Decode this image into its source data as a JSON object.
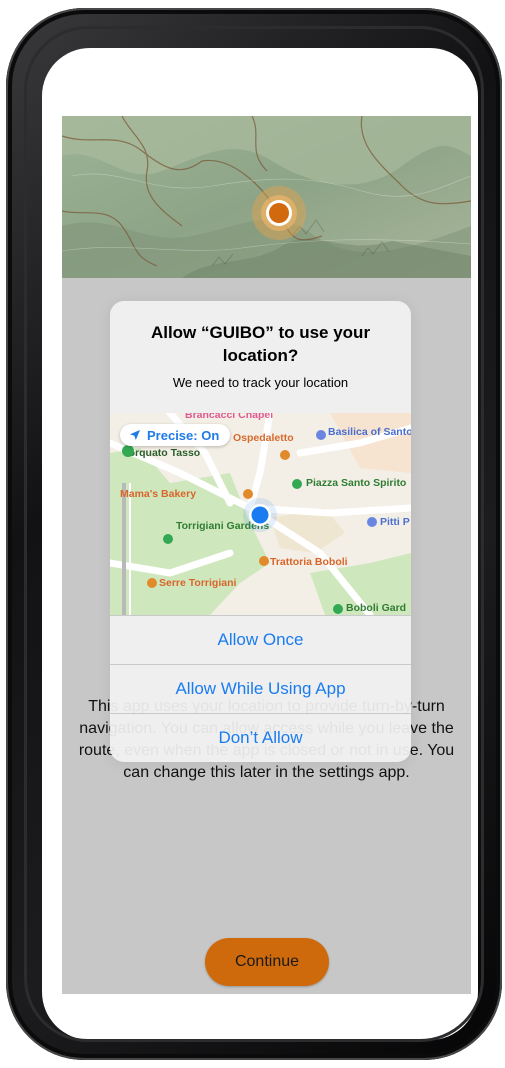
{
  "app": {
    "description": "This app uses your location to provide turn-by-turn navigation. You can allow access while you leave the route, even when the app is closed or not in use. You can change this later in the settings app.",
    "continue_label": "Continue"
  },
  "alert": {
    "title": "Allow “GUIBO” to use your location?",
    "message": "We need to track your location",
    "precise_label": "Precise: On",
    "allow_once_label": "Allow Once",
    "allow_while_using_label": "Allow While Using App",
    "dont_allow_label": "Don’t Allow"
  },
  "map": {
    "places": {
      "brancacci": "Brancacci Chapel",
      "ospedale": "Ospedaletto",
      "santo_spirito": "Basilica of Santo Spirito",
      "torquato": "Torquato Tasso",
      "piazza": "Piazza Santo Spirito",
      "mamas": "Mama's Bakery",
      "torrigiani": "Torrigiani Gardens",
      "pitti": "Pitti P",
      "trattoria": "Trattoria Boboli",
      "serre": "Serre Torrigiani",
      "boboli": "Boboli Gard"
    }
  },
  "colors": {
    "accent_blue": "#1a7cf0",
    "continue_button": "#cf6a0c",
    "location_marker": "#d2690e",
    "app_background": "#c7c7c7"
  },
  "icons": {
    "location_arrow": "location-arrow-icon",
    "user_location_dot": "user-location-dot-icon",
    "map_location_marker": "map-location-marker-icon"
  }
}
